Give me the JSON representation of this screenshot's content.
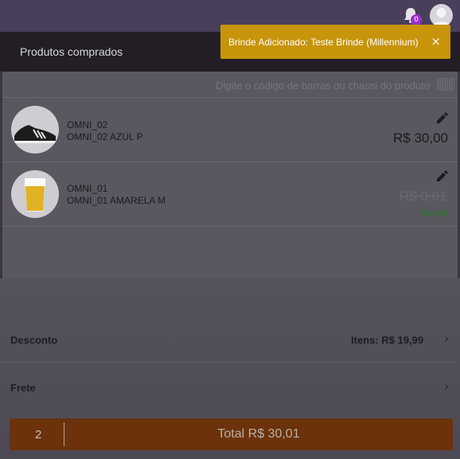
{
  "header": {
    "notification_count": "0",
    "icons": {
      "bell": "bell-icon",
      "avatar": "user-avatar-icon"
    }
  },
  "title_bar": {
    "title": "Produtos comprados"
  },
  "toast": {
    "message": "Brinde Adicionado: Teste Brinde (Millennium)",
    "close_label": "×",
    "color": "#c7940a"
  },
  "search": {
    "placeholder": "Digite o código de barras ou chassi do produto",
    "icon": "barcode-icon"
  },
  "products": [
    {
      "code": "OMNI_02",
      "name": "OMNI_02 AZUL P",
      "price": "R$ 30,00",
      "image": "sneaker",
      "gift": false
    },
    {
      "code": "OMNI_01",
      "name": "OMNI_01 AMARELA M",
      "price": "R$ 0,01",
      "gift_label": "Brinde",
      "image": "beer-glass",
      "gift": true
    }
  ],
  "summary": {
    "discount_label": "Desconto",
    "discount_value": "Itens: R$ 19,99",
    "shipping_label": "Frete"
  },
  "footer": {
    "quantity": "2",
    "total": "Total R$ 30,01",
    "color": "#6b320c"
  },
  "colors": {
    "topbar": "#4a3f5a",
    "titlebar": "#231e26",
    "gift_green": "#2a7a2a"
  }
}
